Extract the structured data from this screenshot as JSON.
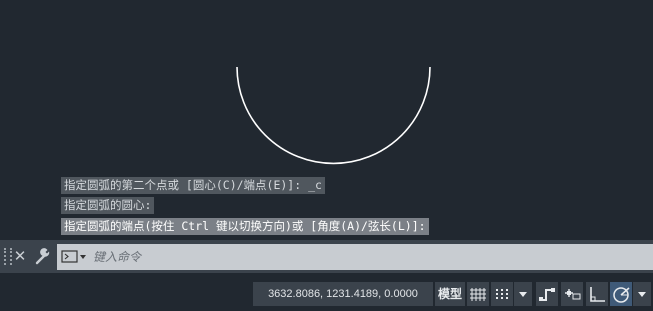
{
  "history": {
    "lines": [
      "指定圆弧的第二个点或 [圆心(C)/端点(E)]: _c",
      "指定圆弧的圆心:",
      "指定圆弧的端点(按住 Ctrl 键以切换方向)或 [角度(A)/弦长(L)]:"
    ]
  },
  "command_line": {
    "close_icon": "close-icon",
    "customize_icon": "wrench-icon",
    "recent_icon": "command-prompt-icon",
    "placeholder": "键入命令"
  },
  "status_bar": {
    "coordinates": "3632.8086, 1231.4189, 0.0000",
    "model_label": "模型",
    "icons": [
      "grid-icon",
      "snap-icon",
      "dropdown-icon",
      "infer-constraints-icon",
      "dynamic-input-icon",
      "ortho-icon",
      "polar-tracking-icon",
      "dropdown-icon"
    ]
  },
  "colors": {
    "canvas": "#212830",
    "arc": "#ffffff",
    "panel": "#3b434c",
    "active": "#3f5a78"
  }
}
